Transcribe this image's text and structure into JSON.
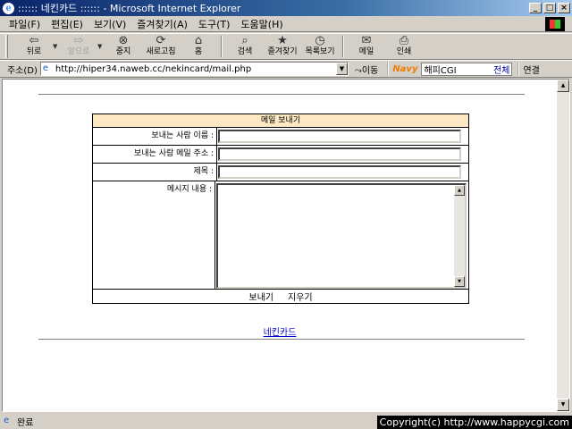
{
  "window": {
    "title": ":::::: 네킨카드 :::::: - Microsoft Internet Explorer",
    "minimize": "_",
    "maximize": "□",
    "close": "×"
  },
  "menu": [
    "파일(F)",
    "편집(E)",
    "보기(V)",
    "즐겨찾기(A)",
    "도구(T)",
    "도움말(H)"
  ],
  "toolbar": {
    "back": "뒤로",
    "forward": "앞으로",
    "stop": "중지",
    "refresh": "새로고침",
    "home": "홈",
    "search": "검색",
    "favorites": "즐겨찾기",
    "history": "목록보기",
    "mail": "메일",
    "print": "인쇄"
  },
  "address": {
    "label": "주소(D)",
    "url": "http://hiper34.naweb.cc/nekincard/mail.php",
    "go": "이동"
  },
  "navy": {
    "logo": "Navy",
    "query": "해피CGI",
    "all": "전체"
  },
  "links": "연결",
  "form": {
    "heading": "메일 보내기",
    "sender_name_label": "보내는 사람 이름 :",
    "sender_email_label": "보내는 사람 메일 주소 :",
    "subject_label": "제목 :",
    "message_label": "메시지 내용 :",
    "sender_name_value": "",
    "sender_email_value": "",
    "subject_value": "",
    "message_value": "",
    "send": "보내기",
    "clear": "지우기"
  },
  "footer_link": "네킨카드",
  "status": {
    "text": "완료",
    "copyright": "Copyright(c) http://www.happycgi.com"
  }
}
